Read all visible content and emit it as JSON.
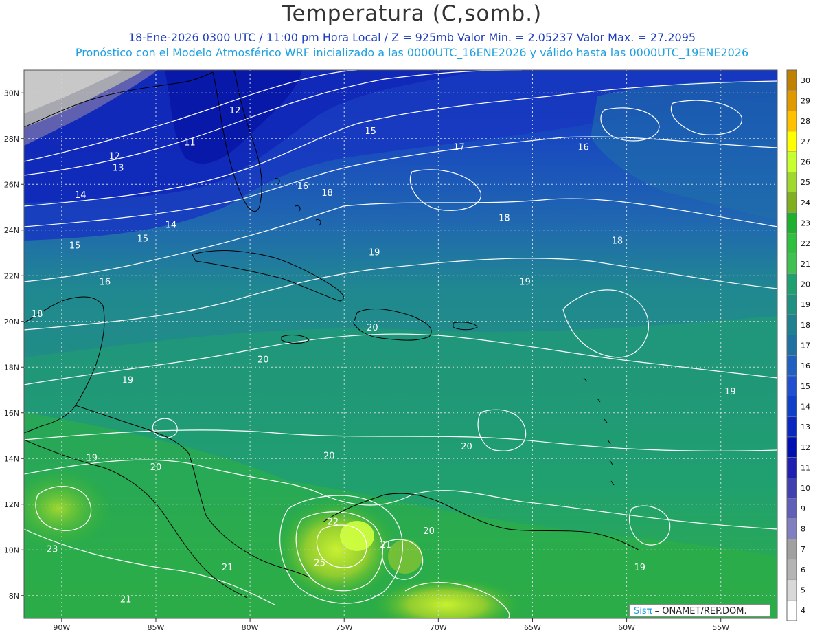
{
  "header": {
    "title": "Temperatura (C,somb.)",
    "line1": "18-Ene-2026  0300 UTC  /  11:00 pm Hora Local  /  Z = 925mb     Valor Min. = 2.05237   Valor Max. = 27.2095",
    "line2": "Pronóstico con el Modelo Atmosférico WRF inicializado a las 0000UTC_16ENE2026 y válido hasta las  0000UTC_19ENE2026"
  },
  "credit": {
    "brand": "Sisπ",
    "rest": " – ONAMET/REP.DOM."
  },
  "chart_data": {
    "type": "heatmap",
    "title": "Temperatura (C,somb.)",
    "variable": "Temperature at 925mb",
    "units": "C",
    "value_min": 2.05237,
    "value_max": 27.2095,
    "lon_range": [
      -92,
      -52
    ],
    "lat_range": [
      7,
      31
    ],
    "x_ticks": [
      "90W",
      "85W",
      "80W",
      "75W",
      "70W",
      "65W",
      "60W",
      "55W"
    ],
    "y_ticks": [
      "8N",
      "10N",
      "12N",
      "14N",
      "16N",
      "18N",
      "20N",
      "22N",
      "24N",
      "26N",
      "28N",
      "30N"
    ],
    "colorbar_levels": [
      "30",
      "29",
      "28",
      "27",
      "26",
      "25",
      "24",
      "23",
      "22",
      "21",
      "20",
      "19",
      "18",
      "17",
      "16",
      "15",
      "14",
      "13",
      "12",
      "11",
      "10",
      "9",
      "8",
      "7",
      "6",
      "5",
      "4"
    ],
    "colorbar_colors": [
      "#c08000",
      "#e09a00",
      "#ffc000",
      "#ffff00",
      "#c8ff30",
      "#a0d830",
      "#80b020",
      "#20b030",
      "#30c040",
      "#40c050",
      "#20a070",
      "#209080",
      "#208090",
      "#2070a0",
      "#2060c0",
      "#2050d0",
      "#1040c8",
      "#0828c0",
      "#0010b0",
      "#2020b0",
      "#4040b0",
      "#6060b8",
      "#8080c0",
      "#a0a0a0",
      "#b4b4b4",
      "#d8d8d8",
      "#ffffff"
    ],
    "contour_labels": [
      {
        "text": "12",
        "lon": -80.8,
        "lat": 29.1
      },
      {
        "text": "15",
        "lon": -73.6,
        "lat": 28.2
      },
      {
        "text": "11",
        "lon": -83.2,
        "lat": 27.7
      },
      {
        "text": "17",
        "lon": -68.9,
        "lat": 27.5
      },
      {
        "text": "16",
        "lon": -62.3,
        "lat": 27.5
      },
      {
        "text": "12",
        "lon": -87.2,
        "lat": 27.1
      },
      {
        "text": "13",
        "lon": -87.0,
        "lat": 26.6
      },
      {
        "text": "16",
        "lon": -77.2,
        "lat": 25.8
      },
      {
        "text": "18",
        "lon": -75.9,
        "lat": 25.5
      },
      {
        "text": "14",
        "lon": -89.0,
        "lat": 25.4
      },
      {
        "text": "14",
        "lon": -84.2,
        "lat": 24.1
      },
      {
        "text": "18",
        "lon": -66.5,
        "lat": 24.4
      },
      {
        "text": "15",
        "lon": -89.3,
        "lat": 23.2
      },
      {
        "text": "15",
        "lon": -85.7,
        "lat": 23.5
      },
      {
        "text": "18",
        "lon": -60.5,
        "lat": 23.4
      },
      {
        "text": "19",
        "lon": -73.4,
        "lat": 22.9
      },
      {
        "text": "16",
        "lon": -87.7,
        "lat": 21.6
      },
      {
        "text": "19",
        "lon": -65.4,
        "lat": 21.6
      },
      {
        "text": "18",
        "lon": -91.3,
        "lat": 20.2
      },
      {
        "text": "20",
        "lon": -73.5,
        "lat": 19.6
      },
      {
        "text": "20",
        "lon": -79.3,
        "lat": 18.2
      },
      {
        "text": "19",
        "lon": -86.5,
        "lat": 17.3
      },
      {
        "text": "19",
        "lon": -54.5,
        "lat": 16.8
      },
      {
        "text": "20",
        "lon": -68.5,
        "lat": 14.4
      },
      {
        "text": "20",
        "lon": -75.8,
        "lat": 14.0
      },
      {
        "text": "19",
        "lon": -88.4,
        "lat": 13.9
      },
      {
        "text": "20",
        "lon": -85.0,
        "lat": 13.5
      },
      {
        "text": "22",
        "lon": -75.6,
        "lat": 11.1
      },
      {
        "text": "20",
        "lon": -70.5,
        "lat": 10.7
      },
      {
        "text": "21",
        "lon": -72.8,
        "lat": 10.1
      },
      {
        "text": "23",
        "lon": -90.5,
        "lat": 9.9
      },
      {
        "text": "25",
        "lon": -76.3,
        "lat": 9.3
      },
      {
        "text": "21",
        "lon": -81.2,
        "lat": 9.1
      },
      {
        "text": "19",
        "lon": -59.3,
        "lat": 9.1
      },
      {
        "text": "21",
        "lon": -86.6,
        "lat": 7.7
      }
    ],
    "grid": true
  }
}
